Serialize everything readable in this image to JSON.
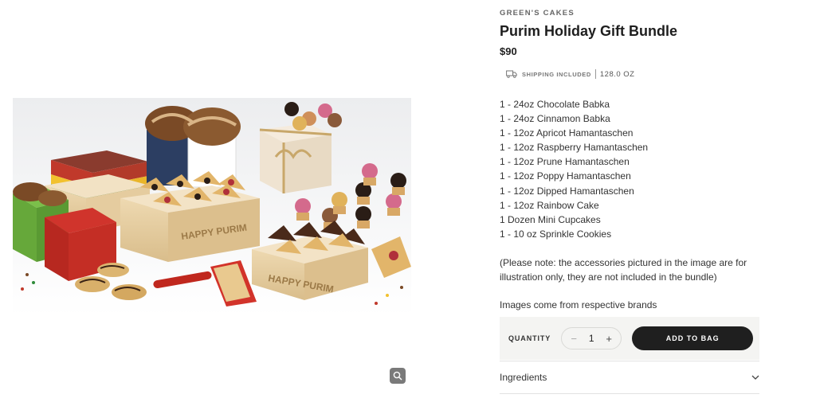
{
  "product": {
    "brand": "GREEN'S CAKES",
    "title": "Purim Holiday Gift Bundle",
    "price": "$90",
    "shipping": "SHIPPING INCLUDED",
    "weight": "128.0 OZ",
    "contents": [
      "1 - 24oz Chocolate Babka",
      "1 - 24oz Cinnamon Babka",
      "1 - 12oz Apricot Hamantaschen",
      "1 - 12oz Raspberry Hamantaschen",
      "1 - 12oz Prune Hamantaschen",
      "1 - 12oz Poppy Hamantaschen",
      "1 - 12oz Dipped Hamantaschen",
      "1 - 12oz Rainbow Cake",
      "1 Dozen Mini Cupcakes",
      "1 - 10 oz Sprinkle Cookies"
    ],
    "note": "(Please note: the accessories pictured in the image are for illustration only, they are not included in the bundle)",
    "images_note": "Images come from respective brands"
  },
  "image": {
    "box_label_1": "HAPPY PURIM",
    "box_label_2": "HAPPY PURIM"
  },
  "purchase": {
    "quantity_label": "QUANTITY",
    "quantity": "1",
    "minus": "−",
    "plus": "+",
    "add_label": "ADD TO BAG"
  },
  "accordion": {
    "ingredients_label": "Ingredients"
  },
  "icons": {
    "zoom": "magnifier-icon",
    "shipping": "truck-icon",
    "accordion": "chevron-down-icon"
  },
  "colors": {
    "button": "#1f1f1f",
    "buy_box": "#f4f4f2",
    "zoom_button": "#7a7a7a"
  }
}
